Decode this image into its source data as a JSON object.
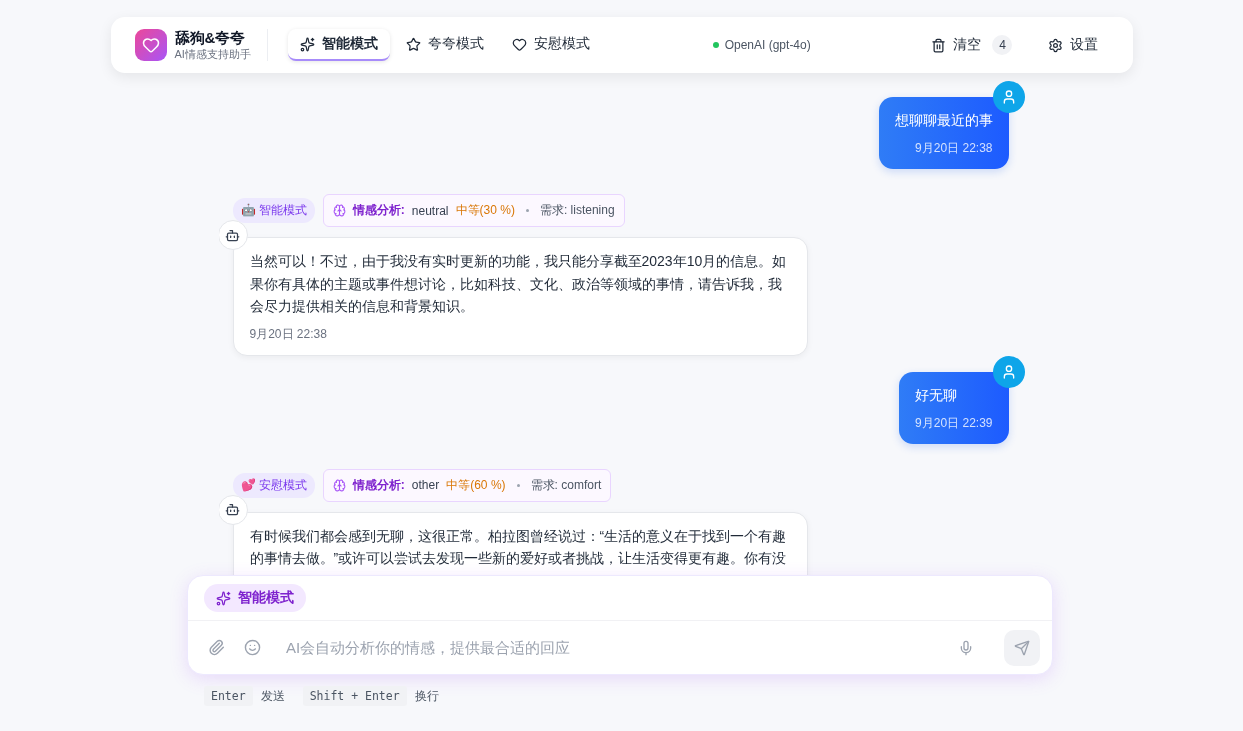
{
  "app": {
    "title": "舔狗&夸夸",
    "subtitle": "AI情感支持助手"
  },
  "tabs": [
    {
      "label": "智能模式",
      "kind": "smart",
      "selected": true
    },
    {
      "label": "夸夸模式",
      "kind": "praise",
      "selected": false
    },
    {
      "label": "安慰模式",
      "kind": "comfort",
      "selected": false
    }
  ],
  "model_status": {
    "label": "OpenAI (gpt-4o)",
    "color": "#22c55e"
  },
  "clear_button": {
    "label": "清空",
    "count": "4"
  },
  "settings_button": {
    "label": "设置"
  },
  "messages": [
    {
      "kind": "user",
      "text": "想聊聊最近的事",
      "time": "9月20日 22:38"
    },
    {
      "kind": "bot",
      "mode_emoji": "🤖",
      "mode_label": "智能模式",
      "analysis_label": "情感分析:",
      "emotion": "neutral",
      "intensity": "中等(30 %)",
      "need": "需求: listening",
      "text": "当然可以！不过，由于我没有实时更新的功能，我只能分享截至2023年10月的信息。如果你有具体的主题或事件想讨论，比如科技、文化、政治等领域的事情，请告诉我，我会尽力提供相关的信息和背景知识。",
      "time": "9月20日 22:38"
    },
    {
      "kind": "user",
      "text": "好无聊",
      "time": "9月20日 22:39"
    },
    {
      "kind": "bot",
      "mode_emoji": "💕",
      "mode_label": "安慰模式",
      "analysis_label": "情感分析:",
      "emotion": "other",
      "intensity": "中等(60 %)",
      "need": "需求: comfort",
      "text": "有时候我们都会感到无聊，这很正常。柏拉图曾经说过：“生活的意义在于找到一个有趣的事情去做。”或许可以尝试去发现一些新的爱好或者挑战，让生活变得更有趣。你有没"
    }
  ],
  "composer": {
    "mode_label": "智能模式",
    "placeholder": "AI会自动分析你的情感，提供最合适的回应"
  },
  "hints": [
    {
      "key": "Enter",
      "action": "发送"
    },
    {
      "key": "Shift + Enter",
      "action": "换行"
    }
  ]
}
